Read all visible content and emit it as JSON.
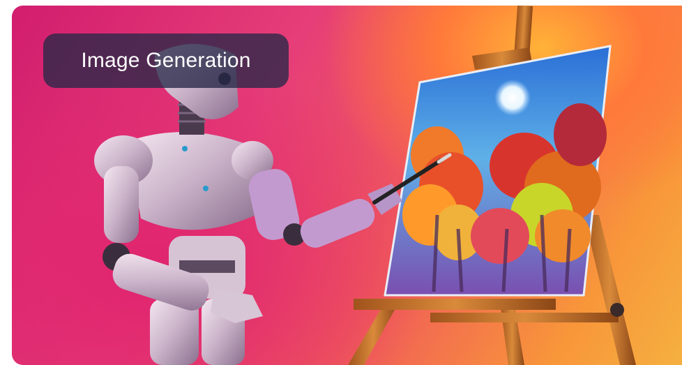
{
  "card": {
    "title": "Image Generation",
    "illustration": "robot-painting-autumn-trees-on-easel",
    "colors": {
      "background_primary": "#d21d6e",
      "background_secondary": "#f8963a",
      "badge_background": "#282848",
      "badge_text": "#ffffff"
    }
  }
}
